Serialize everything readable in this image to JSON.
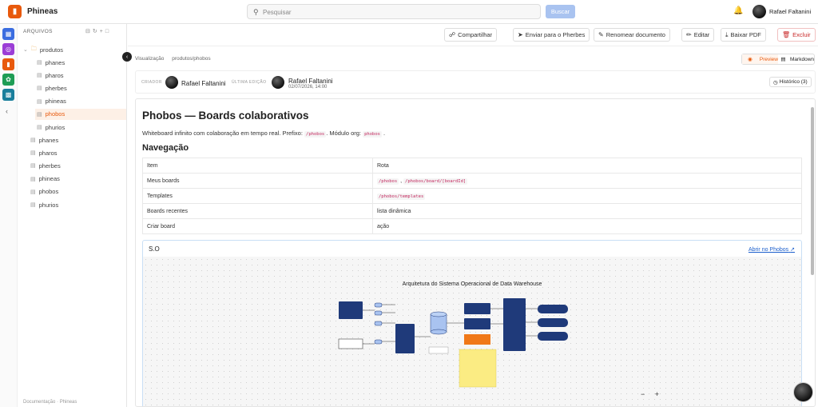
{
  "app": {
    "title": "Phineas",
    "logo_icon": "book-icon"
  },
  "search": {
    "placeholder": "Pesquisar",
    "button": "Buscar"
  },
  "user": {
    "name": "Rafael Faltanini"
  },
  "rail": [
    {
      "icon": "grid-icon",
      "color": "#3b6de0"
    },
    {
      "icon": "compass-icon",
      "color": "#9b3dd6"
    },
    {
      "icon": "book-icon",
      "color": "#e8590c"
    },
    {
      "icon": "leaf-icon",
      "color": "#1f9d55"
    },
    {
      "icon": "chart-icon",
      "color": "#1a7f9c"
    }
  ],
  "files": {
    "header": "ARQUIVOS",
    "folder": "produtos",
    "folder_children": [
      "phanes",
      "pharos",
      "pherbes",
      "phineas",
      "phobos",
      "phurios"
    ],
    "active": "phobos",
    "root_children": [
      "phanes",
      "pharos",
      "pherbes",
      "phineas",
      "phobos",
      "phurios"
    ],
    "footer": "Documentação · Phineas"
  },
  "toolbar": {
    "share": "Compartilhar",
    "send": "Enviar para o Pherbes",
    "rename": "Renomear documento",
    "edit": "Editar",
    "pdf": "Baixar PDF",
    "delete": "Excluir"
  },
  "breadcrumb": {
    "root": "Visualização",
    "path": "produtos/phobos"
  },
  "view": {
    "preview": "Preview",
    "markdown": "Markdown"
  },
  "meta": {
    "created_label": "CRIADOR",
    "created_by": "Rafael Faltanini",
    "edited_label": "ÚLTIMA EDIÇÃO",
    "edited_by": "Rafael Faltanini",
    "edited_at": "02/07/2026, 14:00",
    "history": "Histórico (3)"
  },
  "doc": {
    "title": "Phobos — Boards colaborativos",
    "intro_text": "Whiteboard infinito com colaboração em tempo real. Prefixo:",
    "prefix_code": "/phobos",
    "intro_mid": ". Módulo org:",
    "org_code": "phobos",
    "nav_title": "Navegação",
    "table": [
      {
        "item": "Item",
        "rota": "Rota",
        "code": false
      },
      {
        "item": "Meus boards",
        "rota": "/phobos",
        "rota2": "/phobos/board/[boardId]",
        "code": true
      },
      {
        "item": "Templates",
        "rota": "/phobos/templates",
        "code": true
      },
      {
        "item": "Boards recentes",
        "rota": "lista dinâmica",
        "code": false
      },
      {
        "item": "Criar board",
        "rota": "ação",
        "code": false
      }
    ],
    "embed": {
      "title": "S.O",
      "link": "Abrir no Phobos",
      "diagram_title": "Arquitetura do Sistema Operacional de Data Warehouse"
    }
  },
  "zoom": {
    "out": "−",
    "in": "+"
  }
}
